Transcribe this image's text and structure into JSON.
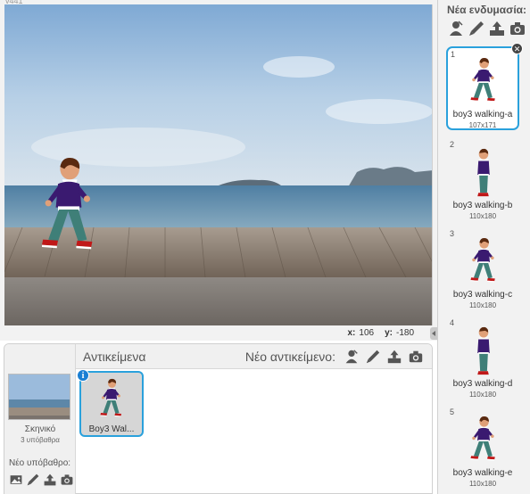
{
  "stage": {
    "version": "v441",
    "coords": {
      "x_label": "x:",
      "x_value": "106",
      "y_label": "y:",
      "y_value": "-180"
    }
  },
  "sprites": {
    "title": "Αντικείμενα",
    "new_sprite_label": "Νέο αντικείμενο:",
    "stage_item": {
      "name": "Σκηνικό",
      "backdrops": "3 υπόβαθρα"
    },
    "new_backdrop_label": "Νέο υπόβαθρο:",
    "sprite_tile": {
      "label": "Boy3 Wal...",
      "info": "i"
    }
  },
  "costumes": {
    "title": "Νέα ενδυμασία:",
    "items": [
      {
        "num": "1",
        "name": "boy3 walking-a",
        "size": "107x171",
        "selected": true
      },
      {
        "num": "2",
        "name": "boy3 walking-b",
        "size": "110x180"
      },
      {
        "num": "3",
        "name": "boy3 walking-c",
        "size": "110x180"
      },
      {
        "num": "4",
        "name": "boy3 walking-d",
        "size": "110x180"
      },
      {
        "num": "5",
        "name": "boy3 walking-e",
        "size": "110x180"
      }
    ]
  },
  "colors": {
    "accent": "#2aa1dc",
    "sky": "#8db4d8",
    "sea": "#5a86a6",
    "deck": "#8a7a68"
  }
}
